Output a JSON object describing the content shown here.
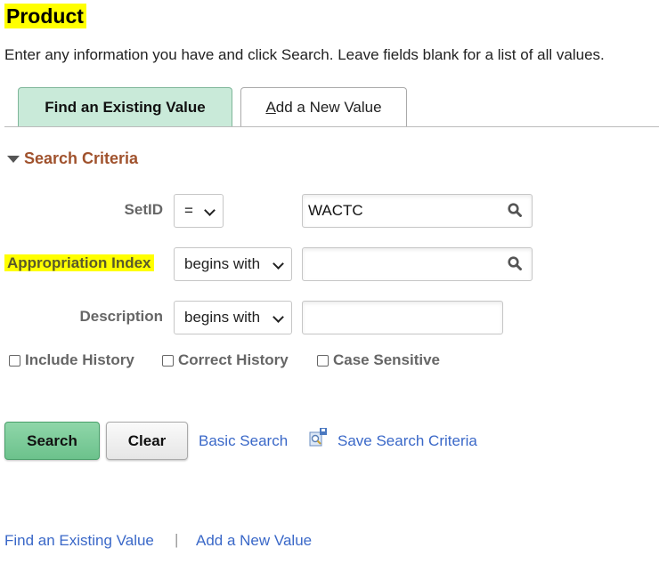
{
  "page": {
    "title": "Product",
    "instructions": "Enter any information you have and click Search. Leave fields blank for a list of all values."
  },
  "tabs": [
    {
      "label": "Find an Existing Value",
      "active": true
    },
    {
      "label_accesskey": "A",
      "label_rest": "dd a New Value",
      "label": "Add a New Value",
      "active": false
    }
  ],
  "search_criteria": {
    "heading": "Search Criteria",
    "fields": [
      {
        "label": "SetID",
        "operator": "=",
        "value": "WACTC",
        "has_lookup": true
      },
      {
        "label": "Appropriation Index",
        "operator": "begins with",
        "value": "",
        "has_lookup": true,
        "highlighted": true
      },
      {
        "label": "Description",
        "operator": "begins with",
        "value": "",
        "has_lookup": false
      }
    ],
    "checkboxes": [
      {
        "label": "Include History",
        "checked": false
      },
      {
        "label": "Correct History",
        "checked": false
      },
      {
        "label": "Case Sensitive",
        "checked": false
      }
    ]
  },
  "actions": {
    "search": "Search",
    "clear": "Clear",
    "basic_search": "Basic Search",
    "save_search_criteria": "Save Search Criteria"
  },
  "footer_links": {
    "find": "Find an Existing Value",
    "separator": "|",
    "add": "Add a New Value"
  },
  "colors": {
    "title_highlight": "#ffff00",
    "active_tab": "#c9ead9",
    "section_heading": "#a0522d",
    "link": "#3a68c8",
    "search_button": "#6cc28c"
  }
}
